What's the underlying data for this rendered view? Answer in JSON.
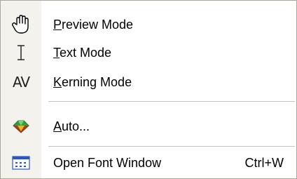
{
  "menu": {
    "items": [
      {
        "icon": "hand-icon",
        "mnemonic": "P",
        "rest": "review Mode",
        "shortcut": ""
      },
      {
        "icon": "text-cursor-icon",
        "mnemonic": "T",
        "rest": "ext Mode",
        "shortcut": ""
      },
      {
        "icon": "kerning-icon",
        "icon_text": "AV",
        "mnemonic": "K",
        "rest": "erning Mode",
        "shortcut": ""
      },
      {
        "icon": "gem-icon",
        "mnemonic": "A",
        "rest": "uto...",
        "shortcut": ""
      },
      {
        "icon": "font-window-icon",
        "mnemonic": "",
        "rest": "Open Font Window",
        "shortcut": "Ctrl+W"
      }
    ]
  },
  "colors": {
    "gutter": "#f3f2ec",
    "border": "#aca899",
    "separator": "#c5c2b8",
    "gem_green": "#2fa33a",
    "gem_red": "#c8201c",
    "window_blue": "#2a57c6"
  }
}
